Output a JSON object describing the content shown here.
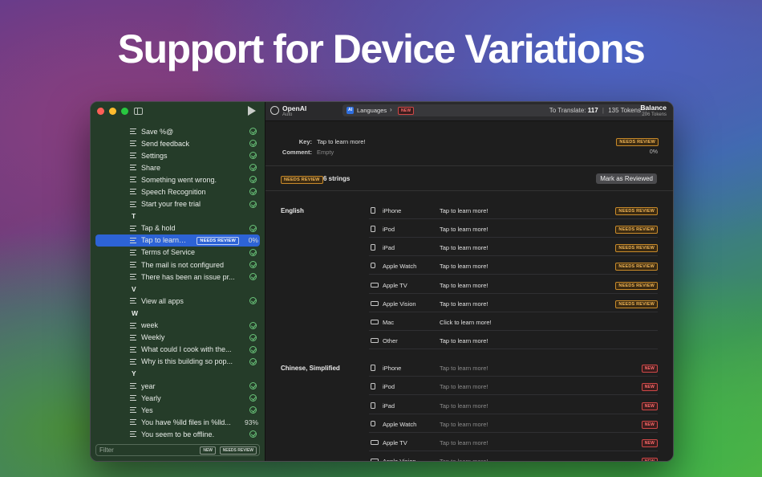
{
  "headline": "Support for Device Variations",
  "sidebar": {
    "rows": [
      {
        "label": "Save %@",
        "kind": "item",
        "status": "check"
      },
      {
        "label": "Send feedback",
        "kind": "item",
        "status": "check"
      },
      {
        "label": "Settings",
        "kind": "item",
        "status": "check"
      },
      {
        "label": "Share",
        "kind": "item",
        "status": "check"
      },
      {
        "label": "Something went wrong.",
        "kind": "item",
        "status": "check"
      },
      {
        "label": "Speech Recognition",
        "kind": "item",
        "status": "check"
      },
      {
        "label": "Start your free trial",
        "kind": "item",
        "status": "check"
      },
      {
        "label": "T",
        "kind": "section"
      },
      {
        "label": "Tap & hold",
        "kind": "item",
        "status": "check"
      },
      {
        "label": "Tap to learn…",
        "kind": "item",
        "selected": true,
        "badge": "NEEDS REVIEW",
        "percent": "0%"
      },
      {
        "label": "Terms of Service",
        "kind": "item",
        "status": "check"
      },
      {
        "label": "The mail is not configured",
        "kind": "item",
        "status": "check"
      },
      {
        "label": "There has been an issue pr...",
        "kind": "item",
        "status": "check"
      },
      {
        "label": "V",
        "kind": "section"
      },
      {
        "label": "View all apps",
        "kind": "item",
        "status": "check"
      },
      {
        "label": "W",
        "kind": "section"
      },
      {
        "label": "week",
        "kind": "item",
        "status": "check"
      },
      {
        "label": "Weekly",
        "kind": "item",
        "status": "check"
      },
      {
        "label": "What could I cook with the...",
        "kind": "item",
        "status": "check"
      },
      {
        "label": "Why is this building so pop...",
        "kind": "item",
        "status": "check"
      },
      {
        "label": "Y",
        "kind": "section"
      },
      {
        "label": "year",
        "kind": "item",
        "status": "check"
      },
      {
        "label": "Yearly",
        "kind": "item",
        "status": "check"
      },
      {
        "label": "Yes",
        "kind": "item",
        "status": "check"
      },
      {
        "label": "You have %lld files in %lld...",
        "kind": "item",
        "percent": "93%"
      },
      {
        "label": "You seem to be offline.",
        "kind": "item",
        "status": "check"
      }
    ],
    "filter": {
      "placeholder": "Filter",
      "tag_new": "NEW",
      "tag_needs_review": "NEEDS REVIEW"
    }
  },
  "toolbar": {
    "provider": "OpenAI",
    "provider_sub": "Auto",
    "ai_chip": "AI",
    "languages": "Languages",
    "new_badge": "NEW",
    "to_translate_label": "To Translate:",
    "to_translate_count": "117",
    "tokens": "135 Tokens",
    "balance_label": "Balance",
    "balance_value": "206 Tokens"
  },
  "detail": {
    "key_label": "Key:",
    "key_value": "Tap to learn more!",
    "comment_label": "Comment:",
    "comment_value": "Empty",
    "status_badge": "NEEDS REVIEW",
    "percent": "0%",
    "strings_badge": "NEEDS REVIEW",
    "strings_count": "6 strings",
    "mark_reviewed": "Mark as Reviewed"
  },
  "groups": [
    {
      "language": "English",
      "rows": [
        {
          "device": "iPhone",
          "icon": "iphone-icon",
          "text": "Tap to learn more!",
          "badge": "NEEDS REVIEW"
        },
        {
          "device": "iPod",
          "icon": "ipod-icon",
          "text": "Tap to learn more!",
          "badge": "NEEDS REVIEW"
        },
        {
          "device": "iPad",
          "icon": "ipad-icon",
          "text": "Tap to learn more!",
          "badge": "NEEDS REVIEW"
        },
        {
          "device": "Apple Watch",
          "icon": "apple-watch-icon",
          "text": "Tap to learn more!",
          "badge": "NEEDS REVIEW"
        },
        {
          "device": "Apple TV",
          "icon": "apple-tv-icon",
          "text": "Tap to learn more!",
          "badge": "NEEDS REVIEW"
        },
        {
          "device": "Apple Vision",
          "icon": "apple-vision-icon",
          "text": "Tap to learn more!",
          "badge": "NEEDS REVIEW"
        },
        {
          "device": "Mac",
          "icon": "mac-icon",
          "text": "Click to learn more!",
          "badge": ""
        },
        {
          "device": "Other",
          "icon": "other-device-icon",
          "text": "Tap to learn more!",
          "badge": ""
        }
      ]
    },
    {
      "language": "Chinese, Simplified",
      "rows": [
        {
          "device": "iPhone",
          "icon": "iphone-icon",
          "text": "Tap to learn more!",
          "badge": "NEW"
        },
        {
          "device": "iPod",
          "icon": "ipod-icon",
          "text": "Tap to learn more!",
          "badge": "NEW"
        },
        {
          "device": "iPad",
          "icon": "ipad-icon",
          "text": "Tap to learn more!",
          "badge": "NEW"
        },
        {
          "device": "Apple Watch",
          "icon": "apple-watch-icon",
          "text": "Tap to learn more!",
          "badge": "NEW"
        },
        {
          "device": "Apple TV",
          "icon": "apple-tv-icon",
          "text": "Tap to learn more!",
          "badge": "NEW"
        },
        {
          "device": "Apple Vision",
          "icon": "apple-vision-icon",
          "text": "Tap to learn more!",
          "badge": "NEW"
        }
      ]
    }
  ],
  "colors": {
    "accent": "#2d63d6",
    "needs_review": "#f0b454",
    "new": "#ff6b6b",
    "check": "#6ac47a"
  }
}
